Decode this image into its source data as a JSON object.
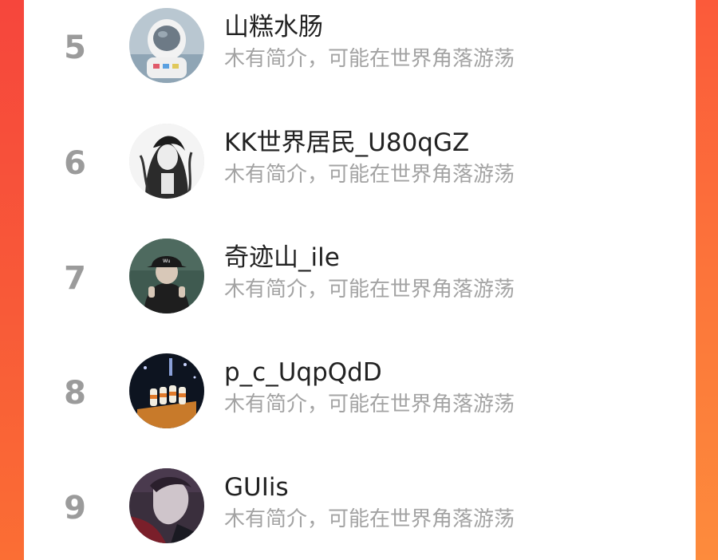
{
  "list": {
    "items": [
      {
        "rank": "5",
        "name": "山糕水肠",
        "bio": "木有简介，可能在世界角落游荡",
        "avatar_icon": "astronaut-avatar"
      },
      {
        "rank": "6",
        "name": "KK世界居民_U80qGZ",
        "bio": "木有简介，可能在世界角落游荡",
        "avatar_icon": "anime-figure-avatar"
      },
      {
        "rank": "7",
        "name": "奇迹山_ile",
        "bio": "木有简介，可能在世界角落游荡",
        "avatar_icon": "cap-person-avatar"
      },
      {
        "rank": "8",
        "name": "p_c_UqpQdD",
        "bio": "木有简介，可能在世界角落游荡",
        "avatar_icon": "drinks-avatar"
      },
      {
        "rank": "9",
        "name": "GUIis",
        "bio": "木有简介，可能在世界角落游荡",
        "avatar_icon": "dark-portrait-avatar"
      }
    ]
  },
  "colors": {
    "background_gradient_top": "#f6463c",
    "background_gradient_bottom": "#fb6e34",
    "rank_color": "#9b9b9b",
    "name_color": "#222222",
    "bio_color": "#a3a3a3"
  }
}
